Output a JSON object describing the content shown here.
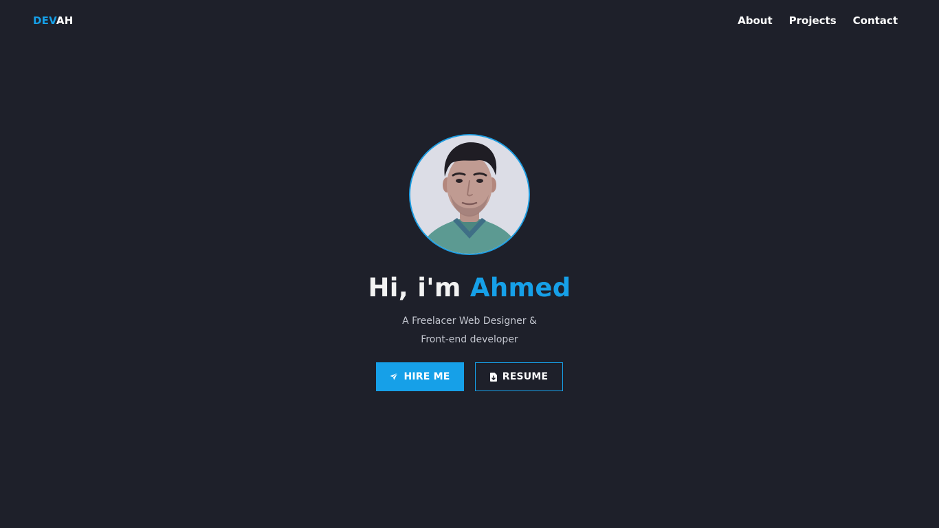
{
  "header": {
    "logo": {
      "accent_text": "DEV",
      "rest_text": "AH"
    },
    "nav": [
      {
        "label": "About"
      },
      {
        "label": "Projects"
      },
      {
        "label": "Contact"
      }
    ]
  },
  "hero": {
    "greeting": "Hi, i'm",
    "name": "Ahmed",
    "subtitle_line1": "A Freelacer Web Designer &",
    "subtitle_line2": "Front-end developer",
    "buttons": {
      "hire": {
        "label": "HIRE ME",
        "icon": "paper-plane-icon"
      },
      "resume": {
        "label": "RESUME",
        "icon": "file-download-icon"
      }
    }
  },
  "colors": {
    "background": "#1e202a",
    "accent": "#16a0e8",
    "text": "#ffffff",
    "muted": "#c3c6cf"
  }
}
